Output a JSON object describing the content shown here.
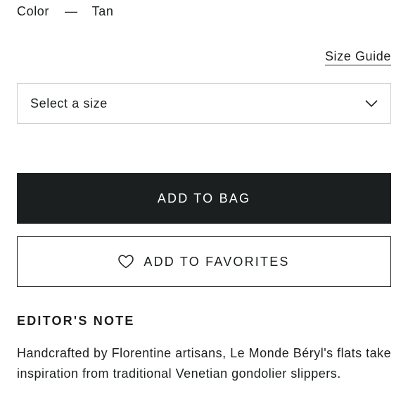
{
  "color": {
    "label": "Color",
    "separator": "—",
    "value": "Tan"
  },
  "size_guide": {
    "label": "Size Guide"
  },
  "size_select": {
    "value": "Select a size",
    "icon": "chevron-down-icon"
  },
  "actions": {
    "add_to_bag": "ADD TO BAG",
    "add_to_favorites": "ADD TO FAVORITES",
    "favorites_icon": "heart-icon"
  },
  "editors_note": {
    "title": "EDITOR'S NOTE",
    "body": "Handcrafted by Florentine artisans, Le Monde Béryl's flats take inspiration from traditional Venetian gondolier slippers."
  },
  "colors": {
    "text": "#1c1f20",
    "button_bg": "#1c1f20",
    "button_text": "#ffffff",
    "select_border": "#cfcfcf"
  }
}
